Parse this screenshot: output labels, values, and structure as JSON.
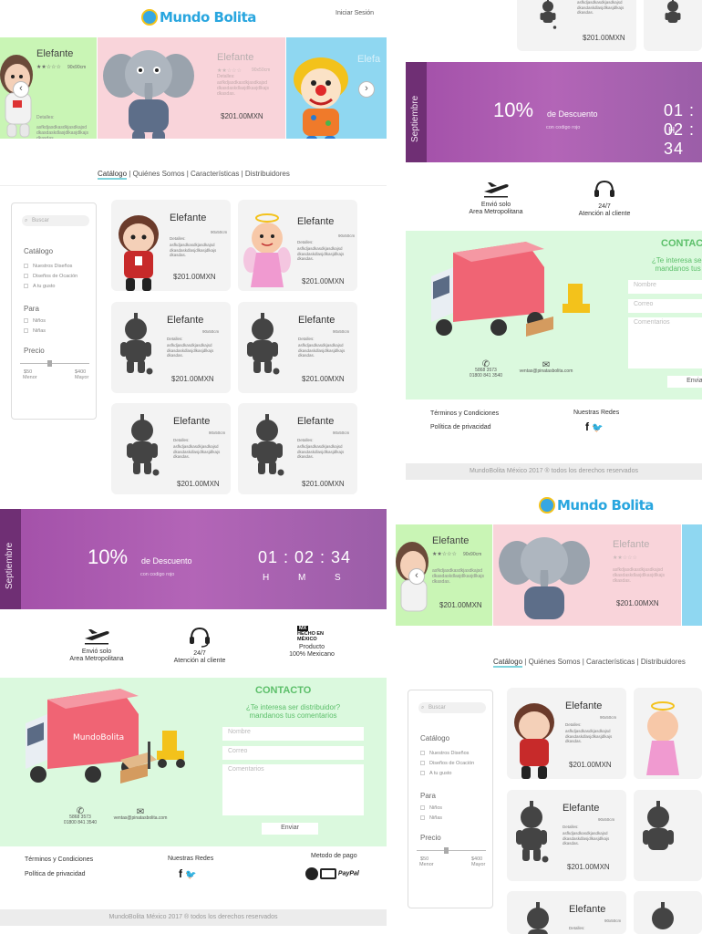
{
  "header": {
    "logo": "Mundo Bolita",
    "login": "Iniciar Sesión"
  },
  "slider": {
    "slides": [
      {
        "name": "Elefante",
        "size": "90x90cm",
        "details_label": "Detalles:",
        "details": "asfkdjasdkasdkjasdkajsd dkasdaskdlasjdlkasjdlkajs dkasdas.",
        "price": "$201.00MXN"
      },
      {
        "name": "Elefante",
        "size": "90x50cm",
        "details_label": "Detalles:",
        "details": "asfkdjasdkasdkjasdkajsd dkasdaskdlasjdlkasjdlkajs dkasdas.",
        "price": "$201.00MXN"
      },
      {
        "name": "Elefa",
        "price": ""
      }
    ],
    "prev_icon": "‹",
    "next_icon": "›"
  },
  "nav": {
    "items": [
      "Catálogo",
      "Quiénes Somos",
      "Características",
      "Distribuidores"
    ]
  },
  "sidebar": {
    "search_placeholder": "Buscar",
    "catalog_title": "Catálogo",
    "catalog_options": [
      "Nuestros Diseños",
      "Diseños de Ocación",
      "A tu gusto"
    ],
    "para_title": "Para",
    "para_options": [
      "Niños",
      "Niñas"
    ],
    "price_title": "Precio",
    "price_min": "$50",
    "price_min_label": "Menor",
    "price_max": "$400",
    "price_max_label": "Mayor",
    "price_level": 0.4
  },
  "products": [
    {
      "name": "Elefante",
      "size": "90x50cm",
      "details_label": "Detalles:",
      "details": "asfkdjasdkasdkjasdkajsd dkasdaskdlasjdlkasjdlkajs dkasdas.",
      "price": "$201.00MXN",
      "image": "doll-icon"
    },
    {
      "name": "Elefante",
      "size": "90x50cm",
      "details_label": "Detalles:",
      "details": "asfkdjasdkasdkjasdkajsd dkasdaskdlasjdlkasjdlkajs dkasdas.",
      "price": "$201.00MXN",
      "image": "angel-icon"
    },
    {
      "name": "Elefante",
      "size": "90x50cm",
      "details_label": "Detalles:",
      "details": "asfkdjasdkasdkjasdkajsd dkasdaskdlasjdlkasjdlkajs dkasdas.",
      "price": "$201.00MXN",
      "image": "silhouette-icon"
    },
    {
      "name": "Elefante",
      "size": "90x50cm",
      "details_label": "Detalles:",
      "details": "asfkdjasdkasdkjasdkajsd dkasdaskdlasjdlkasjdlkajs dkasdas.",
      "price": "$201.00MXN",
      "image": "silhouette-icon"
    },
    {
      "name": "Elefante",
      "size": "90x50cm",
      "details_label": "Detalles:",
      "details": "asfkdjasdkasdkjasdkajsd dkasdaskdlasjdlkasjdlkajs dkasdas.",
      "price": "$201.00MXN",
      "image": "silhouette-icon"
    },
    {
      "name": "Elefante",
      "size": "90x50cm",
      "details_label": "Detalles:",
      "details": "asfkdjasdkasdkjasdkajsd dkasdaskdlasjdlkasjdlkajs dkasdas.",
      "price": "$201.00MXN",
      "image": "silhouette-icon"
    }
  ],
  "promo": {
    "month": "Septiembre",
    "percent": "10%",
    "text": "de Descuento",
    "sub": "con codigo rojo",
    "timer": "01 : 02 : 34",
    "h": "H",
    "m": "M",
    "s": "S"
  },
  "features": [
    {
      "line1": "Envió solo",
      "line2": "Area Metropolitana",
      "icon": "plane-icon"
    },
    {
      "line1": "24/7",
      "line2": "Atención al cliente",
      "icon": "headset-icon"
    },
    {
      "line1": "Producto",
      "line2": "100% Mexicano",
      "icon": "hecho-en-mexico-icon",
      "badge1": "MX",
      "badge2": "HECHO EN",
      "badge3": "MÉXICO"
    }
  ],
  "contact": {
    "title": "CONTACTO",
    "question1": "¿Te interesa ser distribuidor?",
    "question2": "mandanos tus comentarios",
    "name_placeholder": "Nombre",
    "email_placeholder": "Correo",
    "comments_placeholder": "Comentarios",
    "send": "Enviar",
    "phone1": "5868 3573",
    "phone2": "01800 841 3540",
    "email": "ventas@pinatasbolita.com"
  },
  "footer": {
    "terms": "Términos y Condiciones",
    "privacy": "Política de privacidad",
    "social": "Nuestras Redes",
    "payment": "Metodo de pago",
    "paypal": "PayPal",
    "copyright": "MundoBolita México 2017 ® todos los derechos reservados"
  },
  "colors": {
    "green": "#c9f5b5",
    "pink": "#f9d4da",
    "blue": "#8fd7f1",
    "purple": "#a24fa8",
    "contact_bg": "#dbf9de"
  }
}
